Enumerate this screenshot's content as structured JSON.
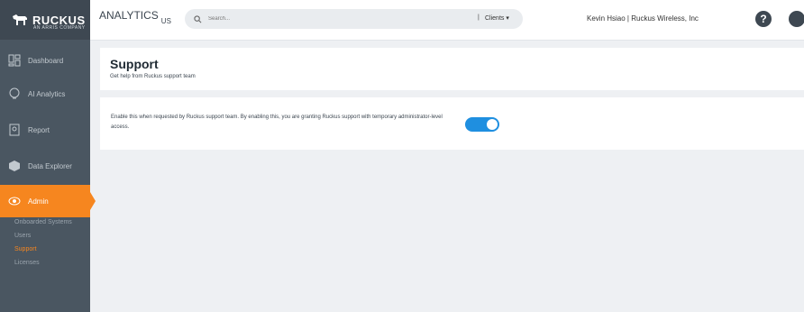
{
  "brand": {
    "name": "RUCKUS",
    "tagline": "AN ARRIS COMPANY"
  },
  "topbar": {
    "app_title": "ANALYTICS",
    "region": "US",
    "search_placeholder": "Search...",
    "scope_separator": "|",
    "scope_label": "Clients ▾",
    "user_label": "Kevin Hsiao | Ruckus Wireless, Inc",
    "help_glyph": "?"
  },
  "sidebar": {
    "items": [
      {
        "label": "Dashboard",
        "icon": "dashboard-icon"
      },
      {
        "label": "AI Analytics",
        "icon": "ai-analytics-icon"
      },
      {
        "label": "Report",
        "icon": "report-icon"
      },
      {
        "label": "Data Explorer",
        "icon": "data-explorer-icon"
      },
      {
        "label": "Admin",
        "icon": "eye-icon",
        "active": true
      }
    ],
    "admin_sub": [
      {
        "label": "Onboarded Systems"
      },
      {
        "label": "Users"
      },
      {
        "label": "Support",
        "active": true
      },
      {
        "label": "Licenses"
      }
    ]
  },
  "page": {
    "title": "Support",
    "subtitle": "Get help from Ruckus support team"
  },
  "support": {
    "description": "Enable this when requested by Ruckus support team. By enabling this, you are granting Ruckus support with temporary administrator-level access.",
    "toggle_on": true
  },
  "colors": {
    "accent": "#f6861f",
    "toggle": "#1f8fe0",
    "sidebar": "#4a5661"
  }
}
